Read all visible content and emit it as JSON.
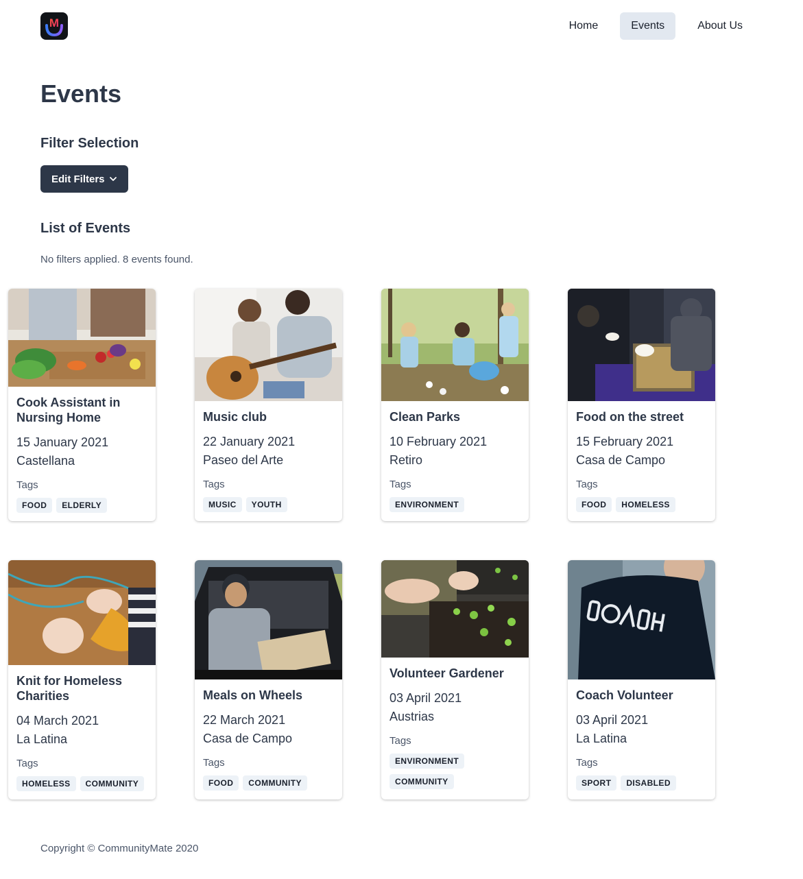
{
  "nav": {
    "logo_letter": "M",
    "links": [
      {
        "label": "Home",
        "active": false
      },
      {
        "label": "Events",
        "active": true
      },
      {
        "label": "About Us",
        "active": false
      }
    ]
  },
  "page": {
    "title": "Events",
    "filter_heading": "Filter Selection",
    "edit_filters_label": "Edit Filters",
    "list_heading": "List of Events",
    "summary": "No filters applied. 8 events found."
  },
  "tags_label": "Tags",
  "events": [
    {
      "title": "Cook Assistant in Nursing Home",
      "date": "15 January 2021",
      "location": "Castellana",
      "tags": [
        "FOOD",
        "ELDERLY"
      ],
      "image": "cooking-photo"
    },
    {
      "title": "Music club",
      "date": "22 January 2021",
      "location": "Paseo del Arte",
      "tags": [
        "MUSIC",
        "YOUTH"
      ],
      "image": "guitar-photo"
    },
    {
      "title": "Clean Parks",
      "date": "10 February 2021",
      "location": "Retiro",
      "tags": [
        "ENVIRONMENT"
      ],
      "image": "park-cleanup-photo"
    },
    {
      "title": "Food on the street",
      "date": "15 February 2021",
      "location": "Casa de Campo",
      "tags": [
        "FOOD",
        "HOMELESS"
      ],
      "image": "food-serving-photo"
    },
    {
      "title": "Knit for Homeless Charities",
      "date": "04 March 2021",
      "location": "La Latina",
      "tags": [
        "HOMELESS",
        "COMMUNITY"
      ],
      "image": "knitting-photo"
    },
    {
      "title": "Meals on Wheels",
      "date": "22 March 2021",
      "location": "Casa de Campo",
      "tags": [
        "FOOD",
        "COMMUNITY"
      ],
      "image": "car-trunk-box-photo"
    },
    {
      "title": "Volunteer Gardener",
      "date": "03 April 2021",
      "location": "Austrias",
      "tags": [
        "ENVIRONMENT",
        "COMMUNITY"
      ],
      "image": "seedlings-photo"
    },
    {
      "title": "Coach Volunteer",
      "date": "03 April 2021",
      "location": "La Latina",
      "tags": [
        "SPORT",
        "DISABLED"
      ],
      "image": "coach-jacket-photo"
    }
  ],
  "footer": {
    "copyright": "Copyright © CommunityMate 2020"
  },
  "colors": {
    "primary_button": "#2d3748",
    "active_nav": "#e2e8f0",
    "tag_bg": "#edf2f7"
  }
}
